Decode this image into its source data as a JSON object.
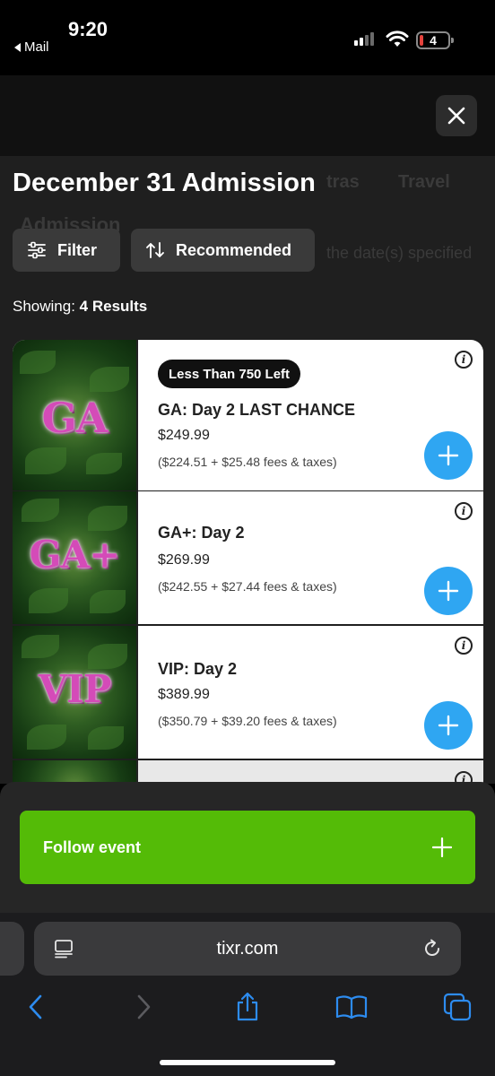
{
  "status_bar": {
    "time": "9:20",
    "back_label": "Mail",
    "battery_level": "4"
  },
  "header": {
    "title": "December 31 Admission",
    "background_tabs": [
      "tras",
      "Travel"
    ],
    "background_subtitle": "Admission",
    "background_note": "the date(s) specified"
  },
  "controls": {
    "filter_label": "Filter",
    "sort_label": "Recommended",
    "showing_label": "Showing:",
    "showing_value": "4 Results"
  },
  "tickets": [
    {
      "badge": "Less Than 750 Left",
      "image_text": "GA",
      "name": "GA: Day 2 LAST CHANCE",
      "price": "$249.99",
      "fees": "($224.51 + $25.48 fees & taxes)"
    },
    {
      "badge": "",
      "image_text": "GA+",
      "name": "GA+: Day 2",
      "price": "$269.99",
      "fees": "($242.55 + $27.44 fees & taxes)"
    },
    {
      "badge": "",
      "image_text": "VIP",
      "name": "VIP: Day 2",
      "price": "$389.99",
      "fees": "($350.79 + $39.20 fees & taxes)"
    }
  ],
  "follow": {
    "label": "Follow event"
  },
  "browser": {
    "url": "tixr.com"
  },
  "colors": {
    "accent_green": "#54bb07",
    "add_button_blue": "#2fa6f2",
    "page_background": "#1f1f1f"
  }
}
